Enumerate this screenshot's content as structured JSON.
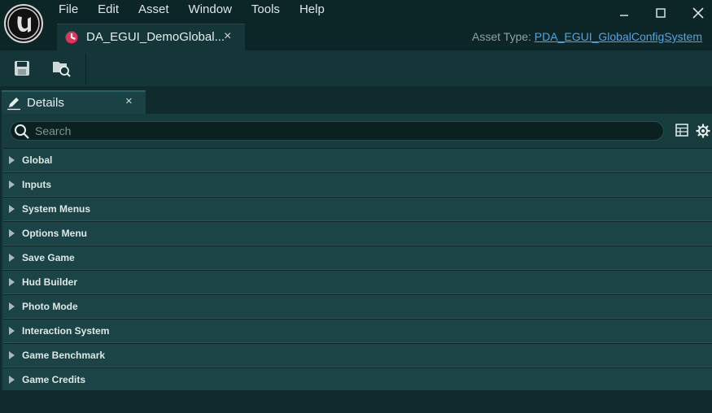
{
  "menu": [
    "File",
    "Edit",
    "Asset",
    "Window",
    "Tools",
    "Help"
  ],
  "window_controls": {
    "minimize_icon": "minimize-icon",
    "maximize_icon": "maximize-icon",
    "close_icon": "close-icon"
  },
  "document_tab": {
    "label": "DA_EGUI_DemoGlobal...",
    "close": "×",
    "icon": "data-asset-icon",
    "icon_color": "#e0335a"
  },
  "asset_type": {
    "label": "Asset Type: ",
    "value": "PDA_EGUI_GlobalConfigSystem"
  },
  "toolbar": {
    "buttons": [
      "save-icon",
      "browse-icon"
    ]
  },
  "details_tab": {
    "label": "Details",
    "close": "×",
    "icon": "pencil-icon"
  },
  "search": {
    "placeholder": "Search",
    "value": ""
  },
  "panel_icons": [
    "table-icon",
    "gear-icon"
  ],
  "categories": [
    {
      "label": "Global"
    },
    {
      "label": "Inputs"
    },
    {
      "label": "System Menus"
    },
    {
      "label": "Options Menu"
    },
    {
      "label": "Save Game"
    },
    {
      "label": "Hud Builder"
    },
    {
      "label": "Photo Mode"
    },
    {
      "label": "Interaction System"
    },
    {
      "label": "Game Benchmark"
    },
    {
      "label": "Game Credits"
    }
  ],
  "colors": {
    "background": "#0f2b2d",
    "accent_link": "#4aa8e8",
    "category_row": "#1b4446"
  }
}
